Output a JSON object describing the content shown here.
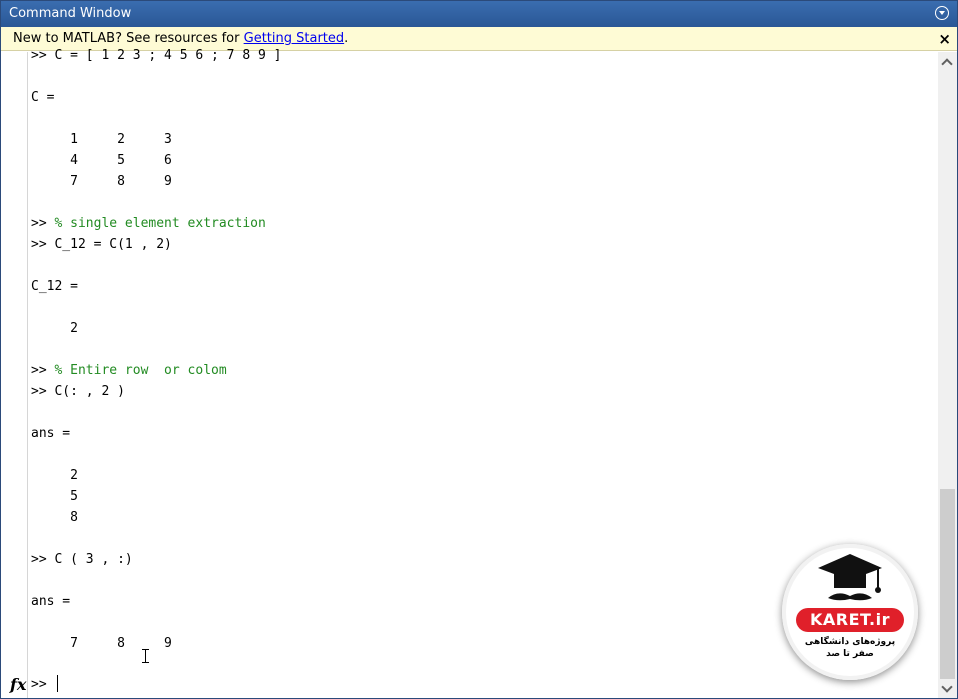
{
  "window": {
    "title": "Command Window"
  },
  "notice": {
    "text": "New to MATLAB? See resources for ",
    "link": "Getting Started",
    "suffix": "."
  },
  "console": {
    "lines": [
      {
        "text": ">> C = [ 1 2 3 ; 4 5 6 ; 7 8 9 ]",
        "type": "command"
      },
      {
        "text": "",
        "type": "blank"
      },
      {
        "text": "C =",
        "type": "output"
      },
      {
        "text": "",
        "type": "blank"
      },
      {
        "text": "     1     2     3",
        "type": "output"
      },
      {
        "text": "     4     5     6",
        "type": "output"
      },
      {
        "text": "     7     8     9",
        "type": "output"
      },
      {
        "text": "",
        "type": "blank"
      },
      {
        "text": ">> % single element extraction",
        "type": "comment"
      },
      {
        "text": ">> C_12 = C(1 , 2)",
        "type": "command"
      },
      {
        "text": "",
        "type": "blank"
      },
      {
        "text": "C_12 =",
        "type": "output"
      },
      {
        "text": "",
        "type": "blank"
      },
      {
        "text": "     2",
        "type": "output"
      },
      {
        "text": "",
        "type": "blank"
      },
      {
        "text": ">> % Entire row  or colom",
        "type": "comment"
      },
      {
        "text": ">> C(: , 2 )",
        "type": "command"
      },
      {
        "text": "",
        "type": "blank"
      },
      {
        "text": "ans =",
        "type": "output"
      },
      {
        "text": "",
        "type": "blank"
      },
      {
        "text": "     2",
        "type": "output"
      },
      {
        "text": "     5",
        "type": "output"
      },
      {
        "text": "     8",
        "type": "output"
      },
      {
        "text": "",
        "type": "blank"
      },
      {
        "text": ">> C ( 3 , :)",
        "type": "command"
      },
      {
        "text": "",
        "type": "blank"
      },
      {
        "text": "ans =",
        "type": "output"
      },
      {
        "text": "",
        "type": "blank"
      },
      {
        "text": "     7     8     9",
        "type": "output"
      }
    ],
    "prompt": ">> ",
    "fx_label": "fx"
  },
  "logo": {
    "brand": "KARET.ir",
    "tagline": "پروژه‌های دانشگاهی صفر تا صد"
  },
  "colors": {
    "titlebar": "#2a5796",
    "notice_bg": "#fefbd5",
    "comment": "#228b22",
    "link": "#0000ee",
    "logo_red": "#e0202a"
  }
}
